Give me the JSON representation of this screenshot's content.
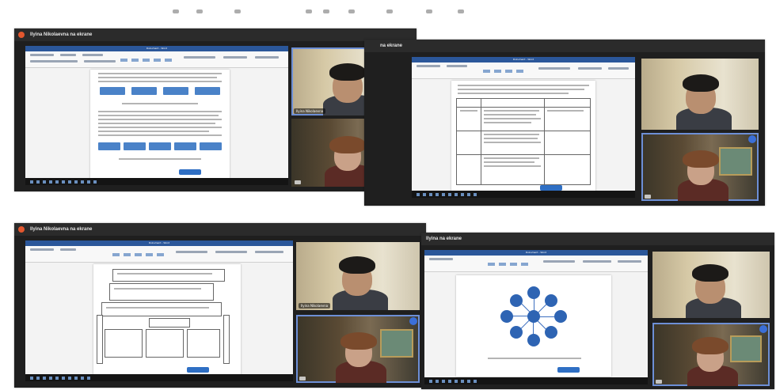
{
  "sessions": [
    {
      "window_title": "Ilyina Nikolaevna na ekrane"
    },
    {
      "window_title": "na ekrane"
    },
    {
      "window_title": "Ilyina Nikolaevna na ekrane"
    },
    {
      "window_title": "Ilyina na ekrane"
    }
  ],
  "participants": {
    "participant_1_label": "Ilyina Nikolaevna",
    "participant_2_label": "",
    "participant_3_label": "Ilyina Nikolaevna"
  },
  "document": {
    "title": "Dokument - Word"
  },
  "colors": {
    "window_bg": "#1f1f1f",
    "titlebar": "#2b2b2b",
    "word_blue": "#2b579a",
    "diagram_blue": "#2e64b3",
    "tile_outline": "#6d8fd6"
  }
}
